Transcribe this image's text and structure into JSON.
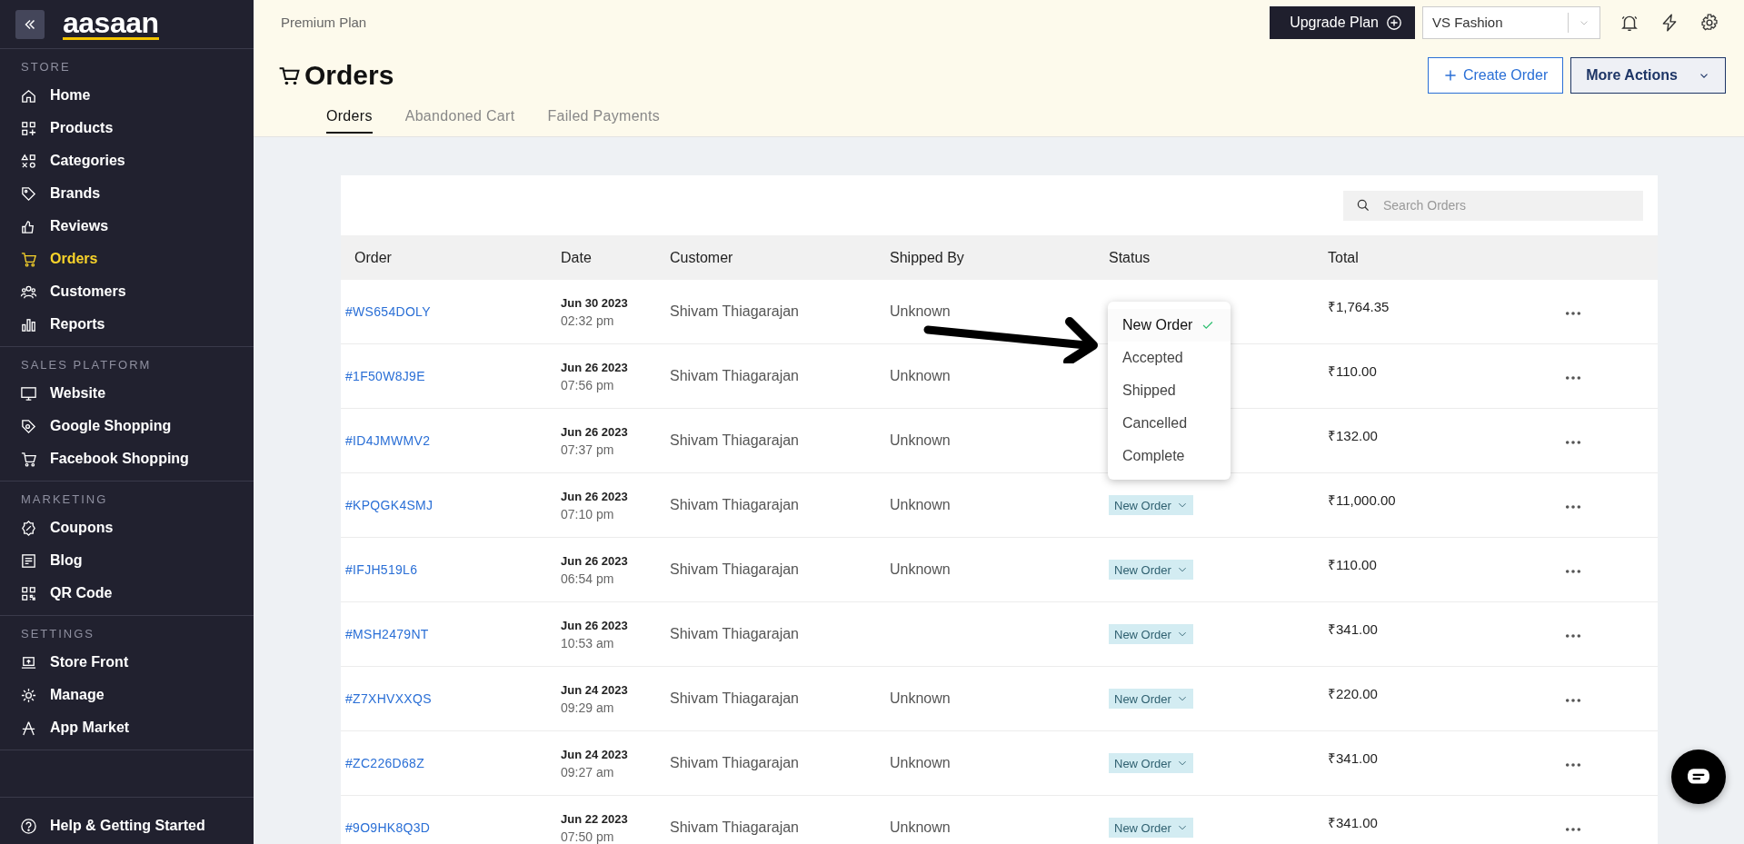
{
  "sidebar": {
    "logo": "aasaan",
    "sections": [
      {
        "title": "STORE",
        "items": [
          {
            "label": "Home",
            "selected": false
          },
          {
            "label": "Products",
            "selected": false
          },
          {
            "label": "Categories",
            "selected": false
          },
          {
            "label": "Brands",
            "selected": false
          },
          {
            "label": "Reviews",
            "selected": false
          },
          {
            "label": "Orders",
            "selected": true
          },
          {
            "label": "Customers",
            "selected": false
          },
          {
            "label": "Reports",
            "selected": false
          }
        ]
      },
      {
        "title": "SALES PLATFORM",
        "items": [
          {
            "label": "Website",
            "selected": false
          },
          {
            "label": "Google Shopping",
            "selected": false
          },
          {
            "label": "Facebook Shopping",
            "selected": false
          }
        ]
      },
      {
        "title": "MARKETING",
        "items": [
          {
            "label": "Coupons",
            "selected": false
          },
          {
            "label": "Blog",
            "selected": false
          },
          {
            "label": "QR Code",
            "selected": false
          }
        ]
      },
      {
        "title": "SETTINGS",
        "items": [
          {
            "label": "Store Front",
            "selected": false
          },
          {
            "label": "Manage",
            "selected": false
          },
          {
            "label": "App Market",
            "selected": false
          }
        ]
      }
    ],
    "help": "Help & Getting Started"
  },
  "header": {
    "plan": "Premium Plan",
    "upgrade": "Upgrade Plan",
    "store_select": "VS Fashion",
    "title": "Orders",
    "actions": [
      {
        "kind": "outline",
        "label": "Create Order"
      },
      {
        "kind": "menu",
        "label": "More Actions"
      }
    ]
  },
  "tabs": [
    {
      "label": "Orders",
      "selected": true
    },
    {
      "label": "Abandoned Cart",
      "selected": false
    },
    {
      "label": "Failed Payments",
      "selected": false
    }
  ],
  "table": {
    "search": {
      "placeholder": "Search Orders"
    },
    "columns": [
      "Order",
      "Date",
      "Customer",
      "Shipped By",
      "Status",
      "Total"
    ],
    "rows": [
      {
        "order": "#WS654DOLY",
        "date": "Jun 30 2023",
        "time": "02:32 pm",
        "customer": "Shivam Thiagarajan",
        "shipped_by": "Unknown",
        "total": "₹1,764.35"
      },
      {
        "order": "#1F50W8J9E",
        "date": "Jun 26 2023",
        "time": "07:56 pm",
        "customer": "Shivam Thiagarajan",
        "shipped_by": "Unknown",
        "total": "₹110.00"
      },
      {
        "order": "#ID4JMWMV2",
        "date": "Jun 26 2023",
        "time": "07:37 pm",
        "customer": "Shivam Thiagarajan",
        "shipped_by": "Unknown",
        "total": "₹132.00"
      },
      {
        "order": "#KPQGK4SMJ",
        "date": "Jun 26 2023",
        "time": "07:10 pm",
        "customer": "Shivam Thiagarajan",
        "shipped_by": "Unknown",
        "status": "New Order",
        "total": "₹11,000.00"
      },
      {
        "order": "#IFJH519L6",
        "date": "Jun 26 2023",
        "time": "06:54 pm",
        "customer": "Shivam Thiagarajan",
        "shipped_by": "Unknown",
        "status": "New Order",
        "total": "₹110.00"
      },
      {
        "order": "#MSH2479NT",
        "date": "Jun 26 2023",
        "time": "10:53 am",
        "customer": "Shivam Thiagarajan",
        "status": "New Order",
        "total": "₹341.00"
      },
      {
        "order": "#Z7XHVXXQS",
        "date": "Jun 24 2023",
        "time": "09:29 am",
        "customer": "Shivam Thiagarajan",
        "shipped_by": "Unknown",
        "status": "New Order",
        "total": "₹220.00"
      },
      {
        "order": "#ZC226D68Z",
        "date": "Jun 24 2023",
        "time": "09:27 am",
        "customer": "Shivam Thiagarajan",
        "shipped_by": "Unknown",
        "status": "New Order",
        "total": "₹341.00"
      },
      {
        "order": "#9O9HK8Q3D",
        "date": "Jun 22 2023",
        "time": "07:50 pm",
        "customer": "Shivam Thiagarajan",
        "shipped_by": "Unknown",
        "status": "New Order",
        "total": "₹341.00"
      }
    ]
  },
  "status_menu": {
    "options": [
      {
        "label": "New Order",
        "selected": true
      },
      {
        "label": "Accepted",
        "selected": false
      },
      {
        "label": "Shipped",
        "selected": false
      },
      {
        "label": "Cancelled",
        "selected": false
      },
      {
        "label": "Complete",
        "selected": false
      }
    ]
  }
}
